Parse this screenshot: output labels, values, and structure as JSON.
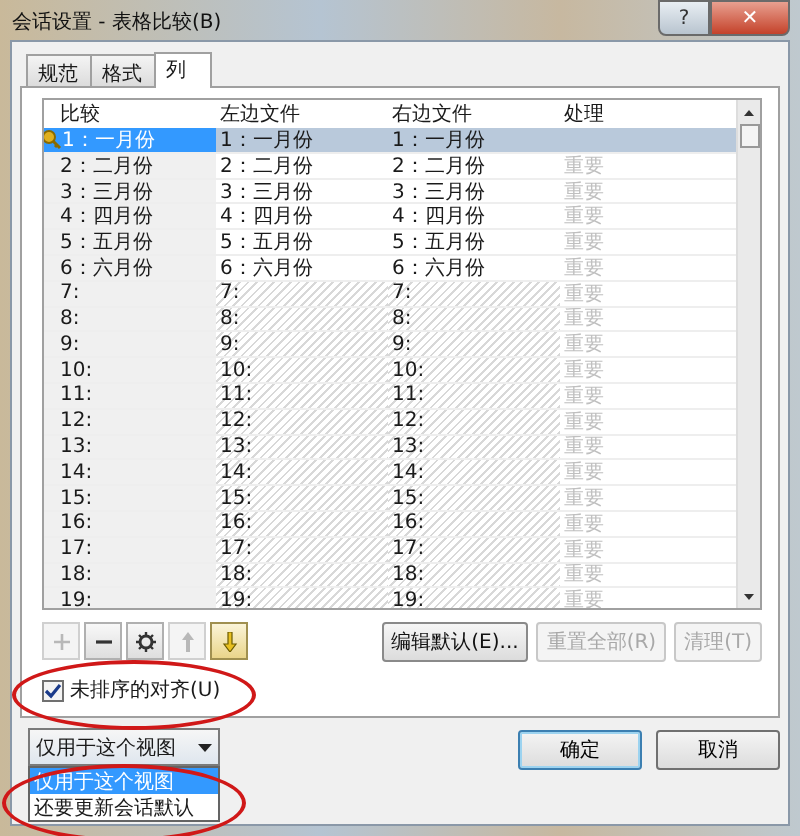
{
  "window": {
    "title": "会话设置 - 表格比较(B)",
    "title_buttons": [
      {
        "kind": "help",
        "label": "?"
      },
      {
        "kind": "close",
        "label": "✕"
      }
    ]
  },
  "tabs": [
    {
      "label": "规范",
      "selected": false
    },
    {
      "label": "格式",
      "selected": false
    },
    {
      "label": "列",
      "selected": true
    }
  ],
  "table": {
    "columns": [
      "比较",
      "左边文件",
      "右边文件",
      "处理"
    ],
    "rows": [
      {
        "compare": "1：一月份",
        "left": "1：一月份",
        "right": "1：一月份",
        "selected": true,
        "unmatched": false,
        "key": true
      },
      {
        "compare": "2：二月份",
        "left": "2：二月份",
        "right": "2：二月份",
        "handling": "重要",
        "selected": false,
        "unmatched": false,
        "key": false
      },
      {
        "compare": "3：三月份",
        "left": "3：三月份",
        "right": "3：三月份",
        "handling": "重要",
        "selected": false,
        "unmatched": false,
        "key": false
      },
      {
        "compare": "4：四月份",
        "left": "4：四月份",
        "right": "4：四月份",
        "handling": "重要",
        "selected": false,
        "unmatched": false,
        "key": false
      },
      {
        "compare": "5：五月份",
        "left": "5：五月份",
        "right": "5：五月份",
        "handling": "重要",
        "selected": false,
        "unmatched": false,
        "key": false
      },
      {
        "compare": "6：六月份",
        "left": "6：六月份",
        "right": "6：六月份",
        "handling": "重要",
        "selected": false,
        "unmatched": false,
        "key": false
      },
      {
        "compare": "7:",
        "left": "7:",
        "right": "7:",
        "handling": "重要",
        "selected": false,
        "unmatched": true,
        "key": false
      },
      {
        "compare": "8:",
        "left": "8:",
        "right": "8:",
        "handling": "重要",
        "selected": false,
        "unmatched": true,
        "key": false
      },
      {
        "compare": "9:",
        "left": "9:",
        "right": "9:",
        "handling": "重要",
        "selected": false,
        "unmatched": true,
        "key": false
      },
      {
        "compare": "10:",
        "left": "10:",
        "right": "10:",
        "handling": "重要",
        "selected": false,
        "unmatched": true,
        "key": false
      },
      {
        "compare": "11:",
        "left": "11:",
        "right": "11:",
        "handling": "重要",
        "selected": false,
        "unmatched": true,
        "key": false
      },
      {
        "compare": "12:",
        "left": "12:",
        "right": "12:",
        "handling": "重要",
        "selected": false,
        "unmatched": true,
        "key": false
      },
      {
        "compare": "13:",
        "left": "13:",
        "right": "13:",
        "handling": "重要",
        "selected": false,
        "unmatched": true,
        "key": false
      },
      {
        "compare": "14:",
        "left": "14:",
        "right": "14:",
        "handling": "重要",
        "selected": false,
        "unmatched": true,
        "key": false
      },
      {
        "compare": "15:",
        "left": "15:",
        "right": "15:",
        "handling": "重要",
        "selected": false,
        "unmatched": true,
        "key": false
      },
      {
        "compare": "16:",
        "left": "16:",
        "right": "16:",
        "handling": "重要",
        "selected": false,
        "unmatched": true,
        "key": false
      },
      {
        "compare": "17:",
        "left": "17:",
        "right": "17:",
        "handling": "重要",
        "selected": false,
        "unmatched": true,
        "key": false
      },
      {
        "compare": "18:",
        "left": "18:",
        "right": "18:",
        "handling": "重要",
        "selected": false,
        "unmatched": true,
        "key": false
      },
      {
        "compare": "19:",
        "left": "19:",
        "right": "19:",
        "handling": "重要",
        "selected": false,
        "unmatched": true,
        "key": false
      }
    ]
  },
  "tool_buttons": [
    {
      "kind": "plus",
      "disabled": true
    },
    {
      "kind": "minus",
      "disabled": false
    },
    {
      "kind": "gear",
      "disabled": false
    },
    {
      "kind": "up",
      "disabled": true
    },
    {
      "kind": "down",
      "disabled": false
    }
  ],
  "action_buttons": [
    {
      "label": "编辑默认(E)...",
      "disabled": false
    },
    {
      "label": "重置全部(R)",
      "disabled": true
    },
    {
      "label": "清理(T)",
      "disabled": true
    }
  ],
  "checkbox": {
    "label": "未排序的对齐(U)",
    "checked": true
  },
  "scope_dropdown": {
    "value": "仅用于这个视图",
    "expanded": true,
    "options": [
      {
        "label": "仅用于这个视图",
        "selected": true
      },
      {
        "label": "还要更新会话默认",
        "selected": false
      }
    ]
  },
  "buttons": [
    {
      "label": "确定",
      "default": true
    },
    {
      "label": "取消",
      "default": false
    }
  ],
  "annotations": [
    {
      "kind": "ellipse"
    },
    {
      "kind": "ellipse"
    }
  ]
}
